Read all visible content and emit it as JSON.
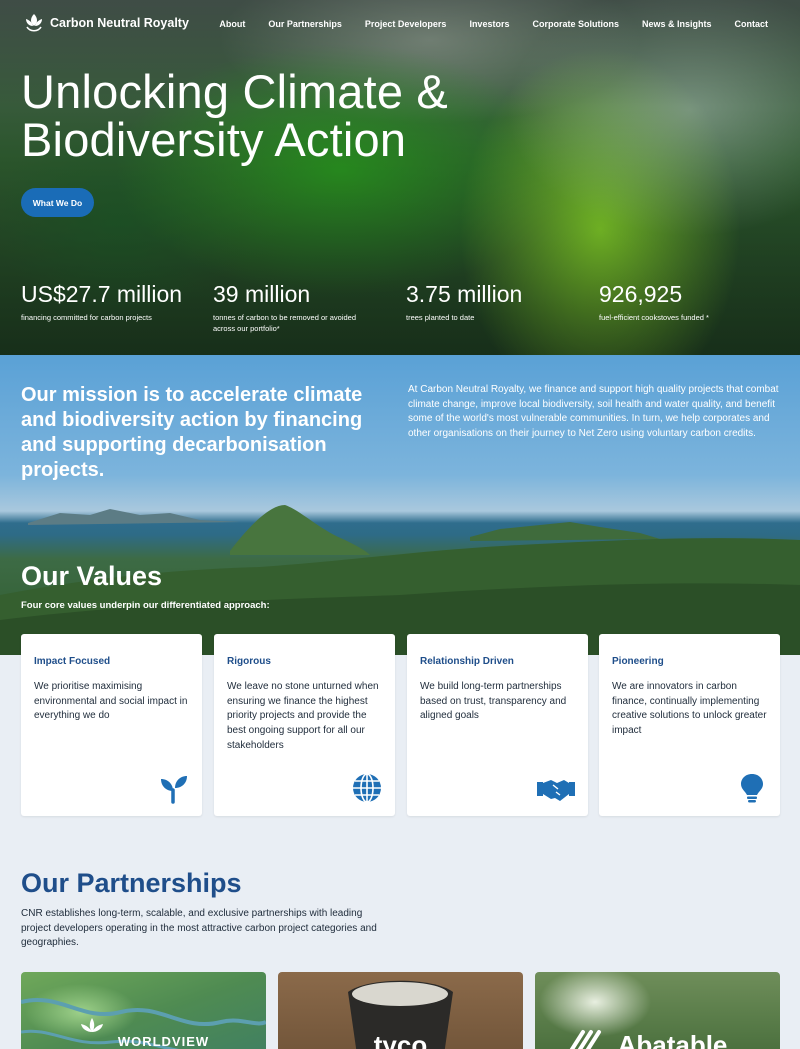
{
  "brand": {
    "name": "Carbon Neutral Royalty",
    "accent": "#1a6cb7",
    "heading_blue": "#1f4e8a"
  },
  "nav": {
    "items": [
      "About",
      "Our Partnerships",
      "Project Developers",
      "Investors",
      "Corporate Solutions",
      "News & Insights",
      "Contact"
    ]
  },
  "hero": {
    "title": "Unlocking Climate & Biodiversity Action",
    "cta": "What We Do"
  },
  "stats": [
    {
      "value": "US$27.7 million",
      "label": "financing committed for carbon projects"
    },
    {
      "value": "39 million",
      "label": "tonnes of carbon to be removed or avoided across our portfolio*"
    },
    {
      "value": "3.75 million",
      "label": "trees planted to date"
    },
    {
      "value": "926,925",
      "label": "fuel-efficient cookstoves funded *"
    }
  ],
  "mission": {
    "heading": "Our mission is to accelerate climate and biodiversity action by financing and supporting decarbonisation projects.",
    "body": "At Carbon Neutral Royalty, we finance and support high quality projects that combat climate change, improve local biodiversity, soil health and water quality, and benefit some of the world's most vulnerable communities. In turn, we help corporates and other organisations on their journey to Net Zero using voluntary carbon credits."
  },
  "values": {
    "title": "Our Values",
    "subtitle": "Four core values underpin our differentiated approach:",
    "cards": [
      {
        "title": "Impact Focused",
        "body": "We prioritise maximising environmental and social impact in everything we do",
        "icon": "seedling-icon"
      },
      {
        "title": "Rigorous",
        "body": "We leave no stone unturned when ensuring we finance the highest priority projects and provide the best ongoing support for all our stakeholders",
        "icon": "globe-icon"
      },
      {
        "title": "Relationship Driven",
        "body": "We build long-term partnerships based on trust, transparency and aligned goals",
        "icon": "handshake-icon"
      },
      {
        "title": "Pioneering",
        "body": "We are innovators in carbon finance, continually implementing creative solutions to unlock greater impact",
        "icon": "lightbulb-icon"
      }
    ]
  },
  "partnerships": {
    "title": "Our Partnerships",
    "body": "CNR establishes long-term, scalable, and exclusive partnerships with leading project developers operating in the most attractive carbon project categories and geographies.",
    "cards": [
      {
        "label": "WORLDVIEW"
      },
      {
        "label": "tyco"
      },
      {
        "label": "Abatable"
      }
    ]
  }
}
